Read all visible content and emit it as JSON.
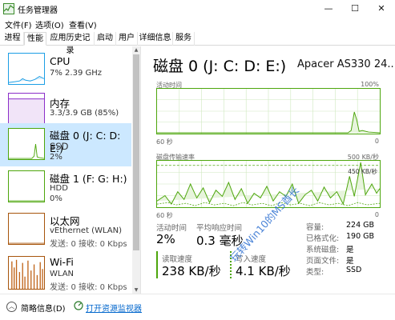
{
  "window": {
    "title": "任务管理器",
    "controls": {
      "minimize": "—",
      "maximize": "☐",
      "close": "✕"
    }
  },
  "menu": [
    "文件(F)",
    "选项(O)",
    "查看(V)"
  ],
  "tabs": [
    "进程",
    "性能",
    "应用历史记录",
    "启动",
    "用户",
    "详细信息",
    "服务"
  ],
  "active_tab": "性能",
  "sidebar": {
    "items": [
      {
        "name": "CPU",
        "sub1": "7% 2.39 GHz",
        "sub2": "",
        "color": "#1c9ee5"
      },
      {
        "name": "内存",
        "sub1": "3.3/3.9 GB (85%)",
        "sub2": "",
        "color": "#8b2fc9"
      },
      {
        "name": "磁盘 0 (J: C: D: E:)",
        "sub1": "SSD",
        "sub2": "2%",
        "color": "#4da60c",
        "active": true
      },
      {
        "name": "磁盘 1 (F: G: H:)",
        "sub1": "HDD",
        "sub2": "0%",
        "color": "#4da60c"
      },
      {
        "name": "以太网",
        "sub1": "vEthernet (WLAN)",
        "sub2": "发送: 0 接收: 0 Kbps",
        "color": "#a7550c"
      },
      {
        "name": "Wi-Fi",
        "sub1": "WLAN",
        "sub2": "发送: 0 接收: 0 Kbps",
        "color": "#a7550c"
      }
    ]
  },
  "detail": {
    "title": "磁盘 0 (J: C: D: E:)",
    "model": "Apacer AS330 24...",
    "graph1": {
      "label_left": "活动时间",
      "label_right": "100%",
      "axis_left": "60 秒",
      "axis_right": "0"
    },
    "graph2": {
      "label_left": "磁盘传输速率",
      "label_right": "500 KB/秒",
      "mark": "450 KB/秒",
      "axis_left": "60 秒",
      "axis_right": "0"
    },
    "stats": {
      "active_time_label": "活动时间",
      "active_time": "2%",
      "avg_response_label": "平均响应时间",
      "avg_response": "0.3 毫秒",
      "read_label": "读取速度",
      "read": "238 KB/秒",
      "write_label": "写入速度",
      "write": "4.1 KB/秒"
    },
    "properties": [
      {
        "label": "容量:",
        "value": "224 GB"
      },
      {
        "label": "已格式化:",
        "value": "190 GB"
      },
      {
        "label": "系统磁盘:",
        "value": "是"
      },
      {
        "label": "页面文件:",
        "value": "是"
      },
      {
        "label": "类型:",
        "value": "SSD"
      }
    ]
  },
  "watermark": "玩转Win10的MS酋长",
  "footer": {
    "fewer_details": "简略信息(D)",
    "open_monitor": "打开资源监视器"
  },
  "colors": {
    "disk_green": "#4da60c",
    "selection": "#cce8ff",
    "link": "#0066cc"
  }
}
